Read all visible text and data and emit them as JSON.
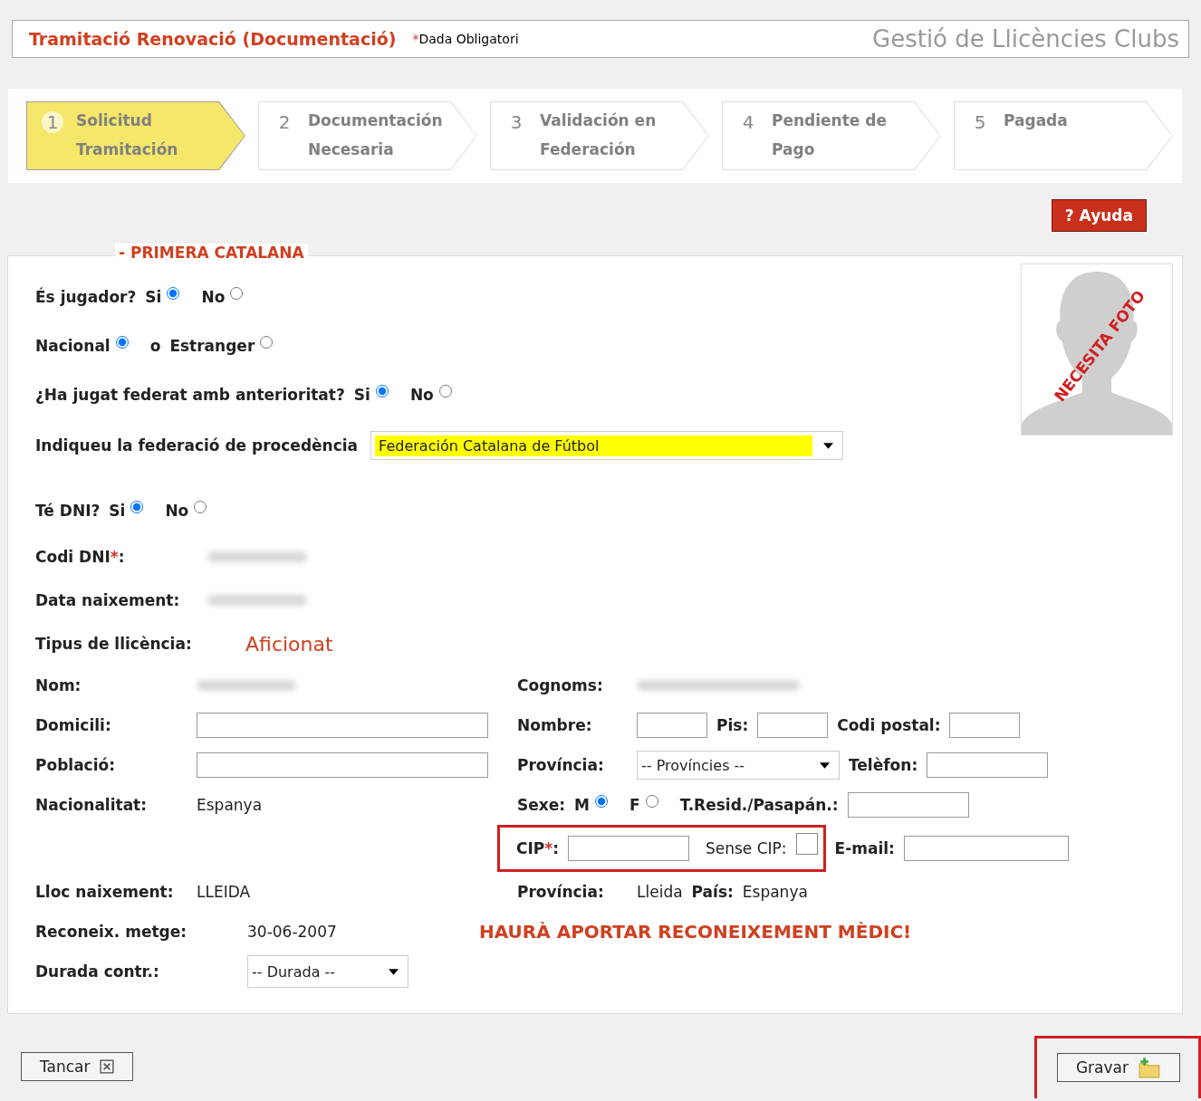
{
  "header": {
    "title": "Tramitació Renovació (Documentació)",
    "required_mark": "*",
    "required_note": "Dada Obligatori",
    "app_name": "Gestió de Llicències Clubs"
  },
  "steps": [
    {
      "number": "1",
      "label": "Solicitud\nTramitación",
      "selected": true
    },
    {
      "number": "2",
      "label": "Documentación\nNecesaria",
      "selected": false
    },
    {
      "number": "3",
      "label": "Validación en\nFederación",
      "selected": false
    },
    {
      "number": "4",
      "label": "Pendiente de\nPago",
      "selected": false
    },
    {
      "number": "5",
      "label": "Pagada",
      "selected": false
    }
  ],
  "help_button": "? Ayuda",
  "section_title": "- PRIMERA CATALANA",
  "photo": {
    "stamp": "NECESITA FOTO"
  },
  "top_rows": [
    {
      "kind": "radio",
      "question": "És jugador?",
      "options": [
        {
          "label": "Si",
          "selected": true
        },
        {
          "label": "No",
          "selected": false
        }
      ]
    },
    {
      "kind": "radio",
      "options": [
        {
          "label": "Nacional",
          "selected": true
        },
        {
          "label": "Estranger",
          "selected": false
        }
      ],
      "separator": "o"
    },
    {
      "kind": "radio",
      "question": "¿Ha jugat federat amb anterioritat?",
      "options": [
        {
          "label": "Si",
          "selected": true
        },
        {
          "label": "No",
          "selected": false
        }
      ]
    },
    {
      "kind": "select",
      "question": "Indiqueu la federació de procedència",
      "value": "Federación Catalana de Fútbol"
    },
    {
      "kind": "radio",
      "question": "Té DNI?",
      "options": [
        {
          "label": "Si",
          "selected": true
        },
        {
          "label": "No",
          "selected": false
        }
      ]
    },
    {
      "kind": "redacted",
      "question": "Codi DNI",
      "required": true,
      "suffix": ":"
    },
    {
      "kind": "redacted",
      "question": "Data naixement:"
    },
    {
      "kind": "highlight",
      "question": "Tipus de llicència:",
      "value": "Aficionat"
    }
  ],
  "required_mark": "*",
  "grid_rows": [
    {
      "left": {
        "kind": "redacted",
        "label": "Nom:"
      },
      "right": [
        {
          "kind": "redacted",
          "label": "Cognoms:"
        }
      ]
    },
    {
      "left": {
        "kind": "input",
        "label": "Domicili:"
      },
      "right": [
        {
          "kind": "input",
          "label": "Nombre:"
        },
        {
          "kind": "input",
          "label": "Pis:"
        },
        {
          "kind": "input",
          "label": "Codi postal:"
        }
      ]
    },
    {
      "left": {
        "kind": "input",
        "label": "Població:"
      },
      "right": [
        {
          "kind": "select",
          "label": "Província:",
          "value": "-- Províncies --"
        },
        {
          "kind": "input",
          "label": "Telèfon:"
        }
      ]
    },
    {
      "left": {
        "kind": "text",
        "label": "Nacionalitat:",
        "value": "Espanya"
      },
      "right": [
        {
          "kind": "radio",
          "label": "Sexe:",
          "options": [
            {
              "label": "M",
              "selected": true
            },
            {
              "label": "F",
              "selected": false
            }
          ]
        },
        {
          "kind": "input",
          "label": "T.Resid./Pasapán.:"
        }
      ]
    },
    {
      "boxed": [
        {
          "kind": "input",
          "label": "CIP",
          "required": true,
          "suffix": ":"
        },
        {
          "kind": "checkbox",
          "label": "Sense CIP:",
          "checked": false
        }
      ],
      "right": [
        {
          "kind": "input",
          "label": "E-mail:"
        }
      ]
    },
    {
      "left": {
        "kind": "text",
        "label": "Lloc naixement:",
        "value": "LLEIDA"
      },
      "right": [
        {
          "kind": "text",
          "label": "Província:",
          "value": "Lleida"
        },
        {
          "kind": "text",
          "label": "País:",
          "value": "Espanya"
        }
      ]
    },
    {
      "left": {
        "kind": "text",
        "label": "Reconeix. metge:",
        "value": "30-06-2007"
      },
      "right": [
        {
          "kind": "warning",
          "value": "HAURÀ APORTAR RECONEIXEMENT MÈDIC!"
        }
      ]
    },
    {
      "left": {
        "kind": "select",
        "label": "Durada contr.:",
        "value": "-- Durada --"
      }
    }
  ],
  "buttons": [
    {
      "label": "Tancar",
      "outlined": false
    },
    {
      "label": "Gravar",
      "outlined": true
    }
  ]
}
